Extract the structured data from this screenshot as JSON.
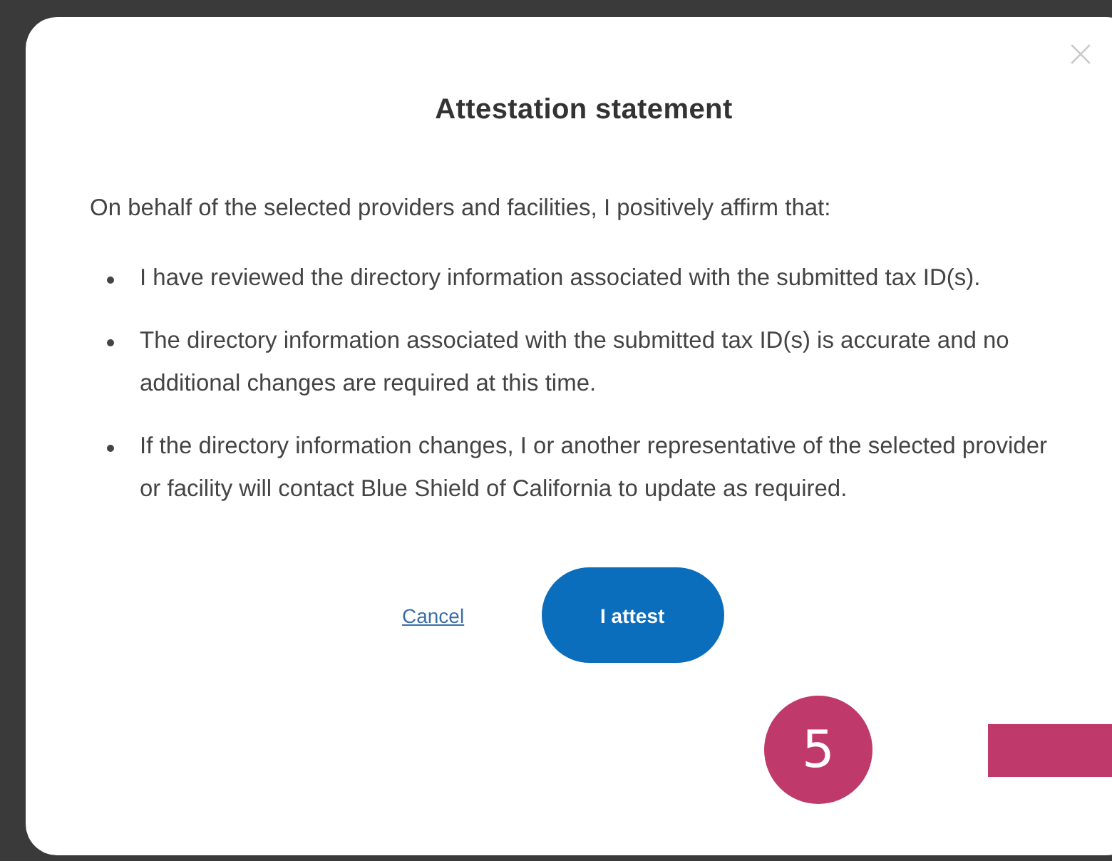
{
  "dialog": {
    "title": "Attestation statement",
    "intro": "On behalf of the selected providers and facilities, I positively affirm that:",
    "statements": [
      "I have reviewed the directory information associated with the submitted tax ID(s).",
      "The directory information associated with the submitted tax ID(s) is accurate and no additional changes are required at this time.",
      "If the directory information changes, I or another representative of the selected provider or facility will contact Blue Shield of California to update as required."
    ],
    "cancel_link": "Cancel",
    "attest_button": "I attest"
  },
  "step_badge": {
    "label": "5",
    "color": "#c0396b"
  }
}
